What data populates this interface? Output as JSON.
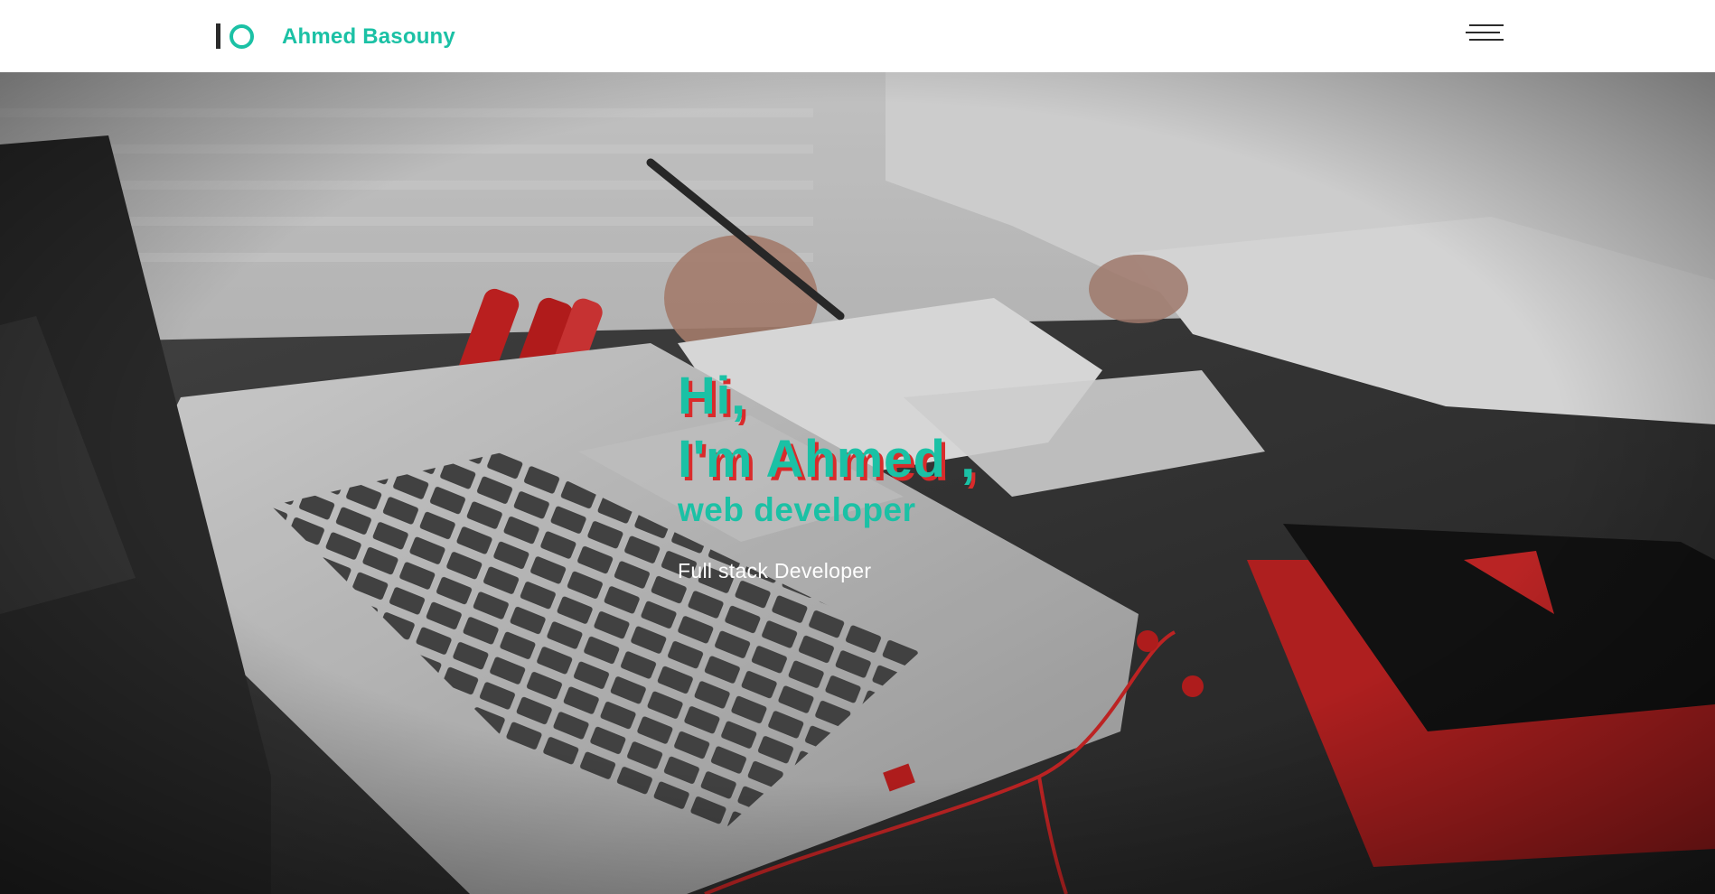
{
  "nav": {
    "brand": "Ahmed Basouny",
    "logo_icon": "io-logo-icon",
    "menu_icon": "hamburger-menu-icon"
  },
  "hero": {
    "greeting": "Hi,",
    "intro": "I'm Ahmed ,",
    "role": "web developer",
    "subtitle": "Full stack Developer",
    "background_image": "laptop-desk-photo"
  },
  "colors": {
    "accent": "#1bc1a5",
    "text_shadow": "#d92b2b",
    "dark": "#2b2b2b",
    "white": "#ffffff"
  }
}
